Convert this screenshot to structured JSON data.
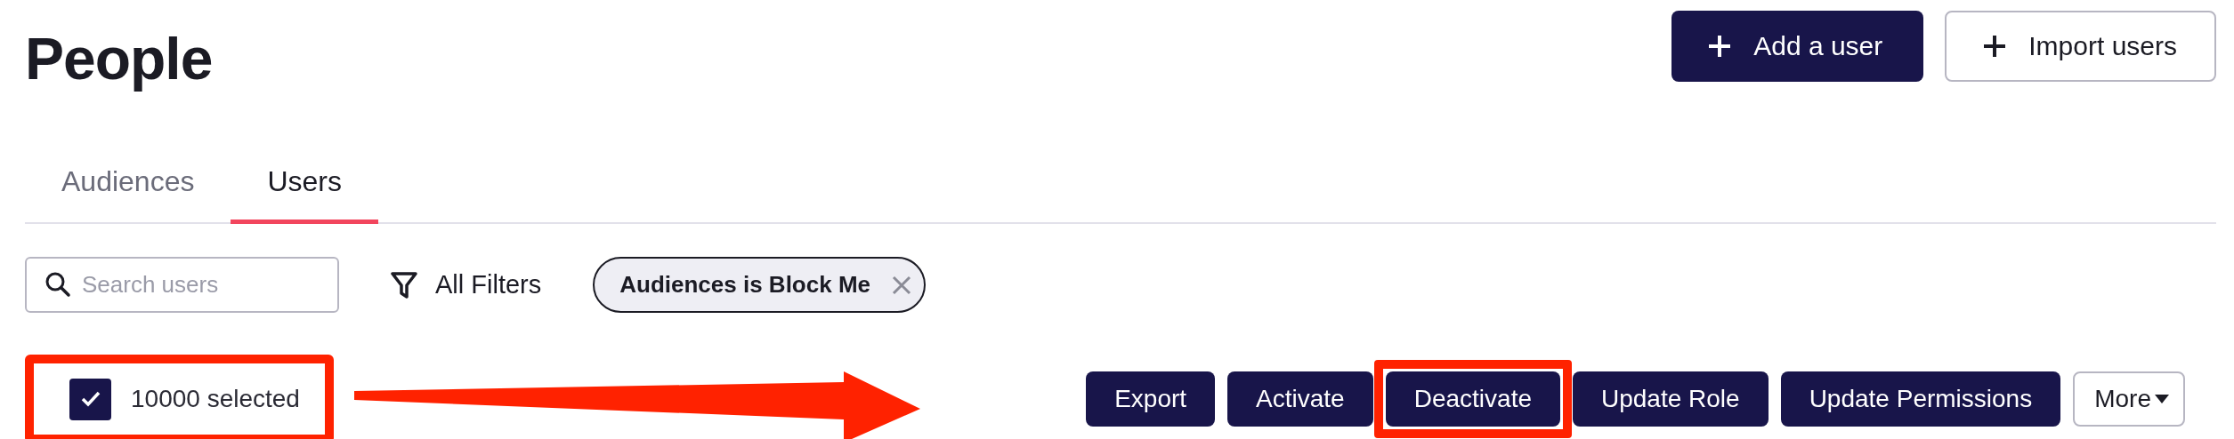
{
  "page": {
    "title": "People"
  },
  "header_buttons": [
    {
      "label": "Add a user",
      "kind": "primary"
    },
    {
      "label": "Import users",
      "kind": "secondary"
    }
  ],
  "tabs": [
    {
      "label": "Audiences",
      "selected": false
    },
    {
      "label": "Users",
      "selected": true
    }
  ],
  "search": {
    "placeholder": "Search users"
  },
  "filters": {
    "label": "All Filters"
  },
  "filter_chips": [
    {
      "label": "Audiences is Block Me"
    }
  ],
  "selection": {
    "label": "10000 selected",
    "checked": true,
    "highlighted": true
  },
  "annotation_arrow": true,
  "actions": [
    {
      "label": "Export",
      "kind": "primary",
      "highlighted": false
    },
    {
      "label": "Activate",
      "kind": "primary",
      "highlighted": false
    },
    {
      "label": "Deactivate",
      "kind": "primary",
      "highlighted": true
    },
    {
      "label": "Update Role",
      "kind": "primary",
      "highlighted": false
    },
    {
      "label": "Update Permissions",
      "kind": "primary",
      "highlighted": false
    },
    {
      "label": "More",
      "kind": "menu",
      "highlighted": false
    }
  ]
}
